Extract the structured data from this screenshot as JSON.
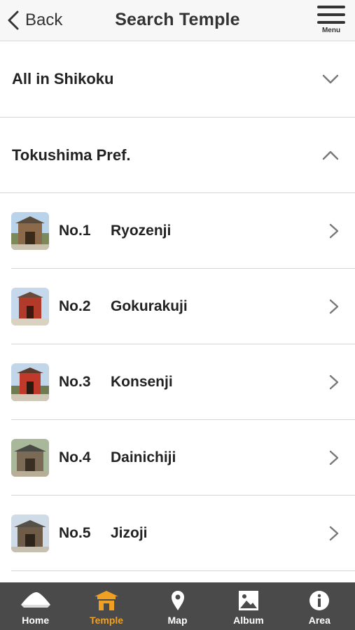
{
  "header": {
    "back_label": "Back",
    "title": "Search Temple",
    "menu_label": "Menu"
  },
  "sections": [
    {
      "label": "All in Shikoku",
      "expanded": false
    },
    {
      "label": "Tokushima Pref.",
      "expanded": true
    }
  ],
  "temples": [
    {
      "number": "No.1",
      "name": "Ryozenji"
    },
    {
      "number": "No.2",
      "name": "Gokurakuji"
    },
    {
      "number": "No.3",
      "name": "Konsenji"
    },
    {
      "number": "No.4",
      "name": "Dainichiji"
    },
    {
      "number": "No.5",
      "name": "Jizoji"
    }
  ],
  "tabs": [
    {
      "label": "Home",
      "icon": "home-hat-icon",
      "active": false
    },
    {
      "label": "Temple",
      "icon": "temple-icon",
      "active": true
    },
    {
      "label": "Map",
      "icon": "map-pin-icon",
      "active": false
    },
    {
      "label": "Album",
      "icon": "album-icon",
      "active": false
    },
    {
      "label": "Area",
      "icon": "info-icon",
      "active": false
    }
  ],
  "colors": {
    "active_tab": "#f0a020",
    "tabbar_bg": "#4a4a4a",
    "header_bg": "#f7f7f7"
  }
}
